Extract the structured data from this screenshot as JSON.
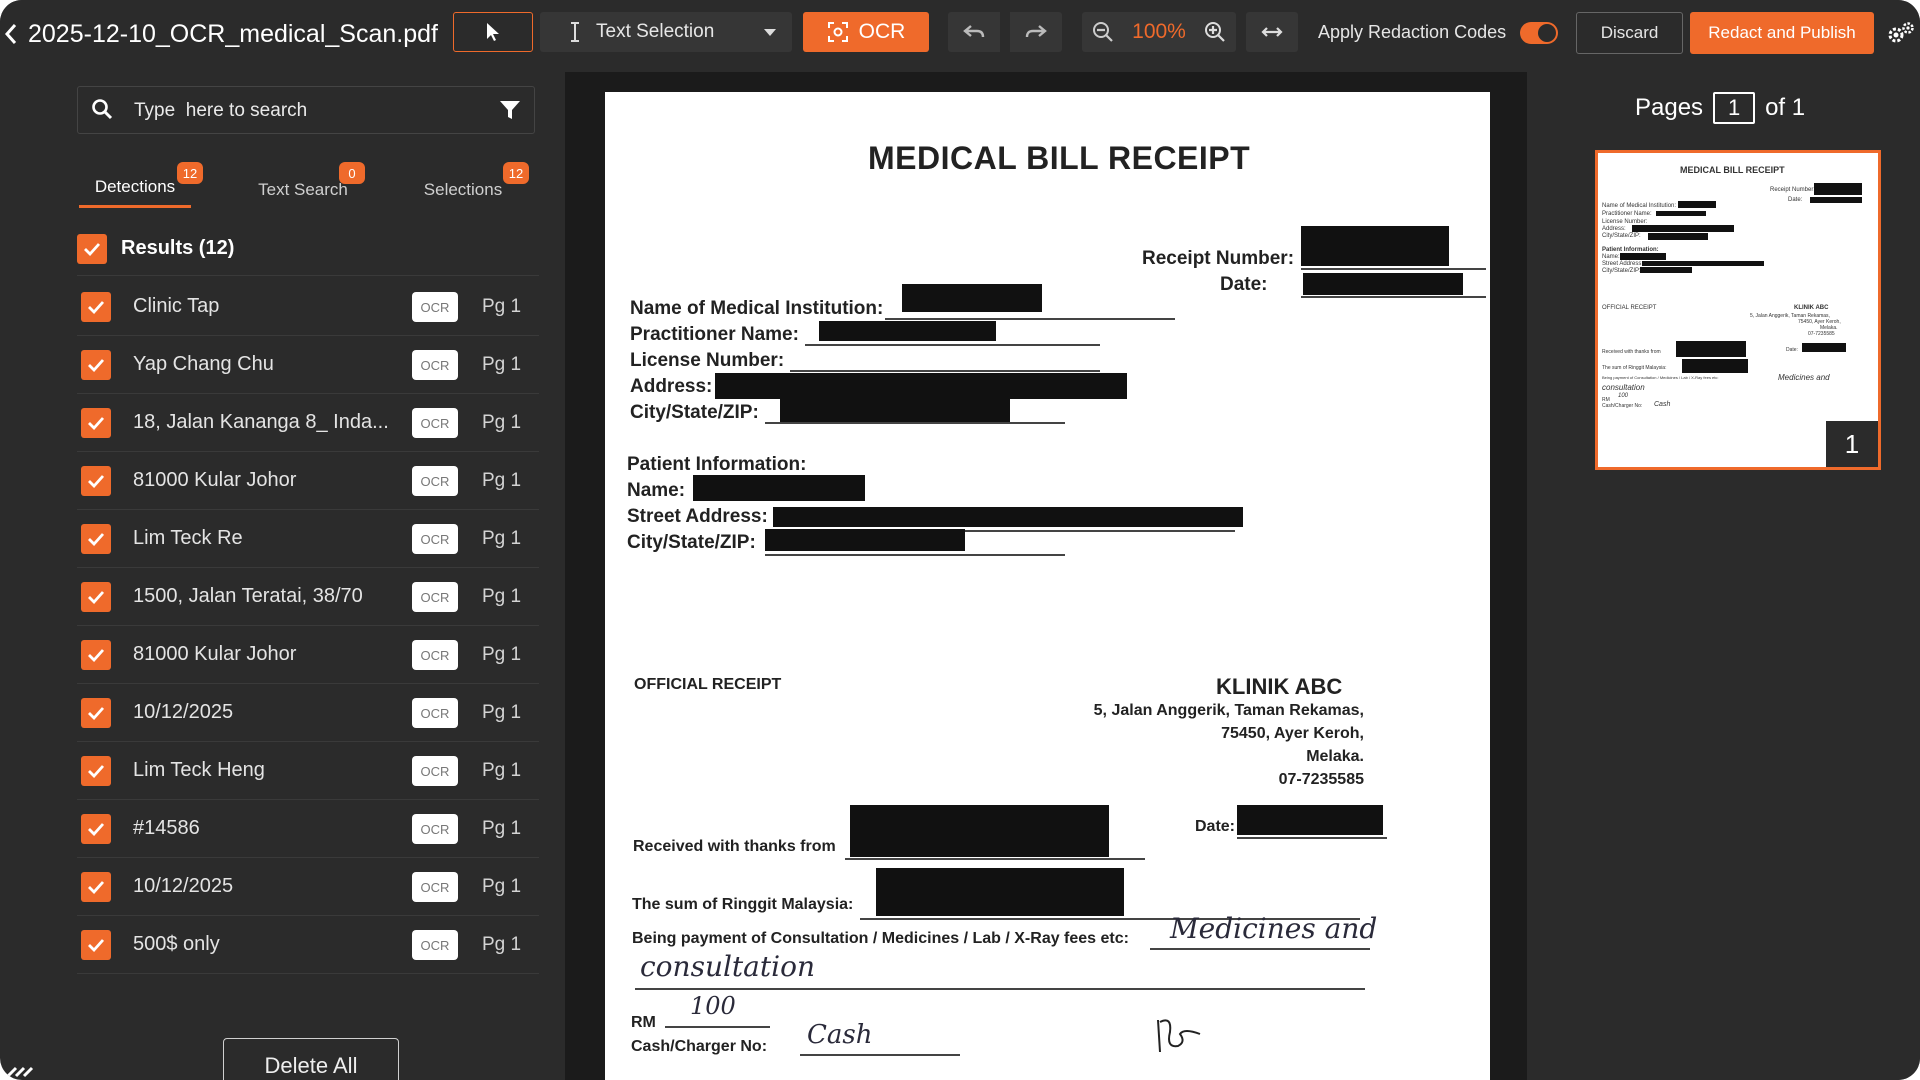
{
  "toolbar": {
    "doc_title": "2025-12-10_OCR_medical_Scan.pdf",
    "text_selection_label": "Text Selection",
    "ocr_label": "OCR",
    "zoom": "100%",
    "apply_redaction_label": "Apply Redaction Codes",
    "apply_redaction_on": true,
    "discard_label": "Discard",
    "publish_label": "Redact and Publish",
    "accent": "#ef6a2b"
  },
  "sidebar": {
    "search_placeholder": "Type  here to search",
    "tabs": [
      {
        "label": "Detections",
        "count": "12"
      },
      {
        "label": "Text Search",
        "count": "0"
      },
      {
        "label": "Selections",
        "count": "12"
      }
    ],
    "results_label": "Results (12)",
    "tag_label": "OCR",
    "page_label": "Pg 1",
    "results": [
      {
        "text": "Clinic Tap"
      },
      {
        "text": "Yap Chang Chu"
      },
      {
        "text": "18, Jalan Kananga 8_ Inda..."
      },
      {
        "text": "81000 Kular Johor"
      },
      {
        "text": "Lim Teck Re"
      },
      {
        "text": "1500, Jalan Teratai, 38/70"
      },
      {
        "text": "81000 Kular Johor"
      },
      {
        "text": "10/12/2025"
      },
      {
        "text": "Lim Teck Heng"
      },
      {
        "text": "#14586"
      },
      {
        "text": "10/12/2025"
      },
      {
        "text": "500$ only"
      }
    ],
    "delete_all_label": "Delete All"
  },
  "document": {
    "title": "MEDICAL BILL RECEIPT",
    "receipt_number_label": "Receipt Number:",
    "date_label": "Date:",
    "institution_label": "Name of Medical Institution:",
    "practitioner_label": "Practitioner Name:",
    "license_label": "License Number:",
    "address_label": "Address:",
    "city_label": "City/State/ZIP:",
    "patient_info_label": "Patient Information:",
    "patient_name_label": "Name:",
    "street_label": "Street Address:",
    "patient_city_label": "City/State/ZIP:",
    "official_receipt_label": "OFFICIAL RECEIPT",
    "clinic_name": "KLINIK ABC",
    "clinic_address_1": "5, Jalan Anggerik, Taman Rekamas,",
    "clinic_address_2": "75450, Ayer Keroh,",
    "clinic_address_3": "Melaka.",
    "clinic_phone": "07-7235585",
    "received_label": "Received with thanks from",
    "date2_label": "Date:",
    "sum_label": "The sum of Ringgit Malaysia:",
    "payment_label": "Being payment of Consultation / Medicines / Lab / X-Ray fees etc:",
    "payment_hand_1": "Medicines and",
    "payment_hand_2": "consultation",
    "rm_label": "RM",
    "rm_value": "100",
    "cash_label": "Cash/Charger No:",
    "cash_value": "Cash"
  },
  "pages": {
    "label": "Pages",
    "current": "1",
    "of_label": "of 1",
    "thumb_number": "1"
  }
}
